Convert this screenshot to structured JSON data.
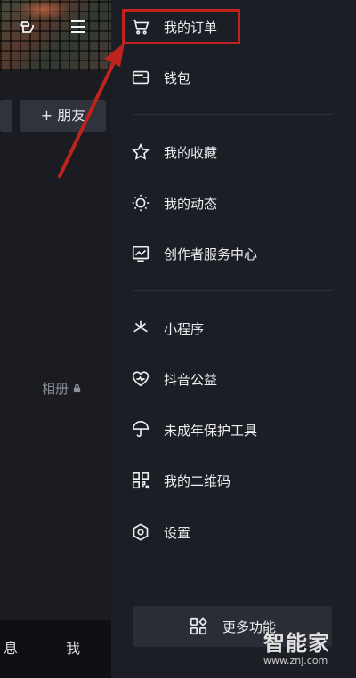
{
  "left": {
    "friend_tab": "+ 朋友",
    "album_label": "相册",
    "bottom_msg": "息",
    "bottom_me": "我"
  },
  "menu": {
    "orders": "我的订单",
    "wallet": "钱包",
    "favorites": "我的收藏",
    "activity": "我的动态",
    "creator": "创作者服务中心",
    "miniprogram": "小程序",
    "charity": "抖音公益",
    "minor": "未成年保护工具",
    "qrcode": "我的二维码",
    "settings": "设置",
    "more": "更多功能"
  },
  "watermark": {
    "logo": "智能家",
    "url": "www.znj.com"
  },
  "colors": {
    "highlight": "#c0221d",
    "drawer_bg": "#1c1e25"
  },
  "icons": [
    "hand-icon",
    "menu-icon",
    "cart-icon",
    "wallet-icon",
    "star-icon",
    "sun-icon",
    "chart-icon",
    "mini-program-icon",
    "heart-icon",
    "umbrella-icon",
    "qr-icon",
    "gear-icon",
    "grid-icon",
    "lock-icon"
  ]
}
